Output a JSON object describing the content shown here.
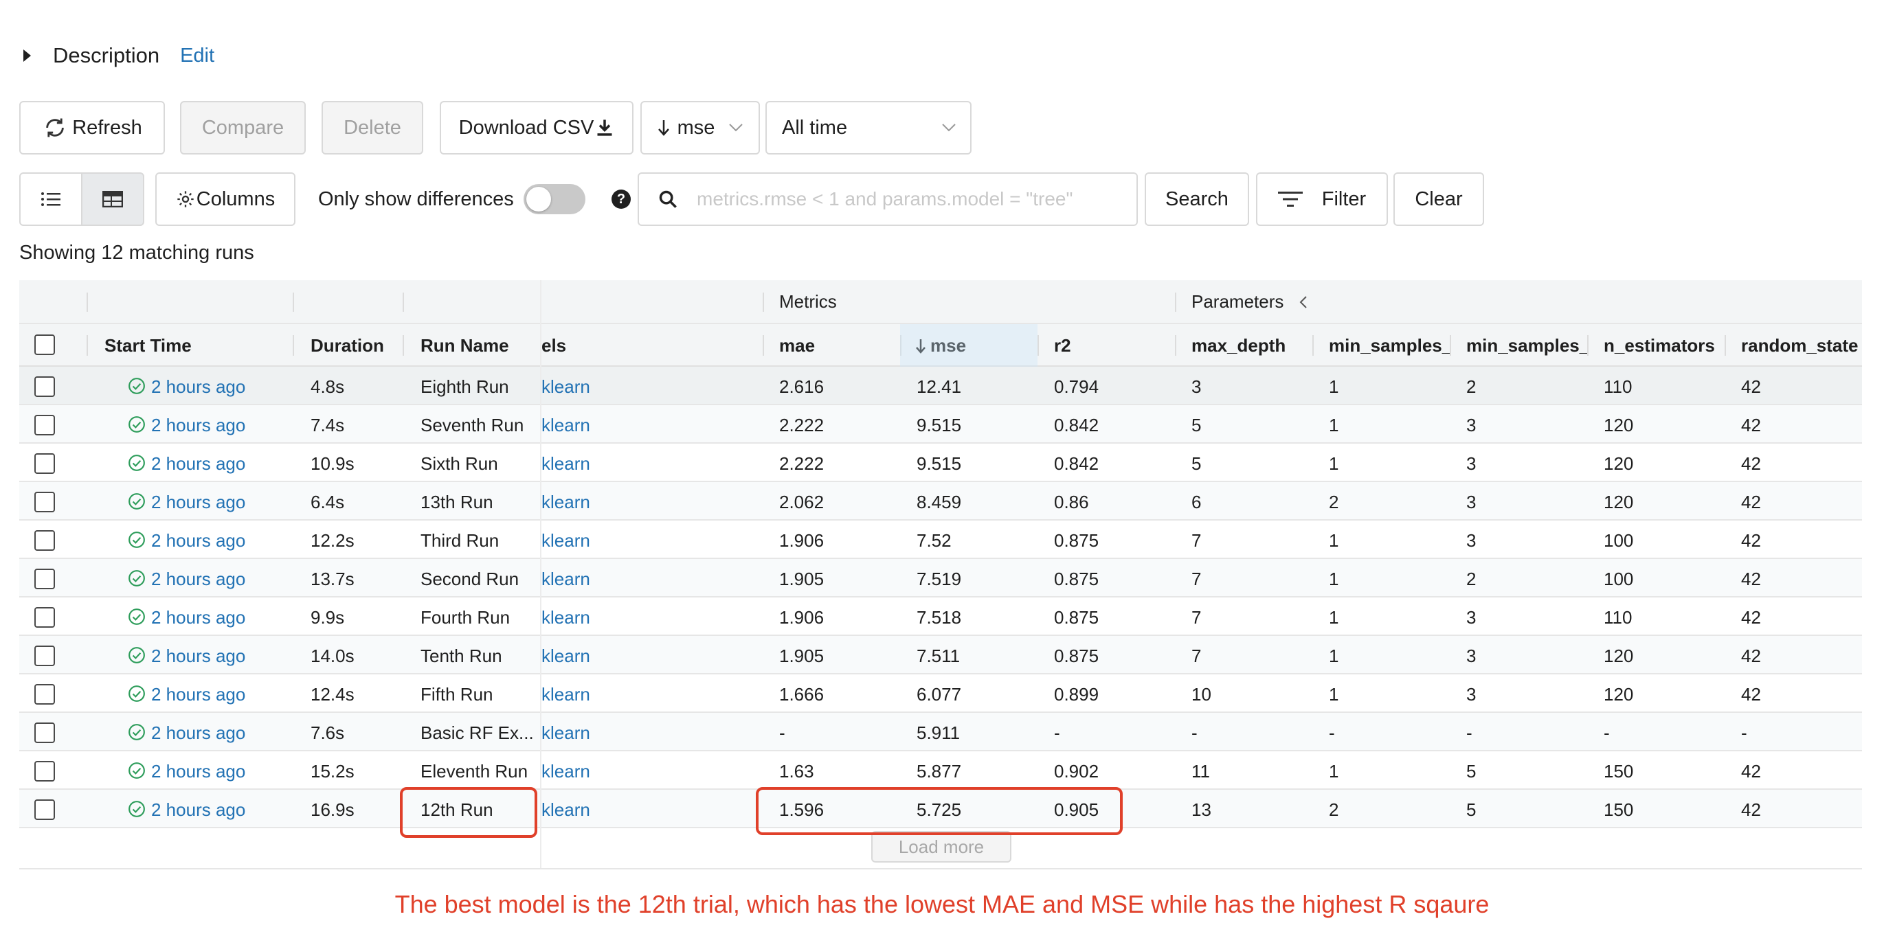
{
  "description": {
    "title": "Description",
    "edit_label": "Edit"
  },
  "toolbar": {
    "refresh_label": "Refresh",
    "compare_label": "Compare",
    "delete_label": "Delete",
    "download_label": "Download CSV",
    "sort_label": "mse",
    "time_label": "All time"
  },
  "filter_bar": {
    "columns_label": "Columns",
    "only_diff_label": "Only show differences",
    "search_placeholder": "metrics.rmse < 1 and params.model = \"tree\"",
    "search_label": "Search",
    "filter_label": "Filter",
    "clear_label": "Clear"
  },
  "count_text": "Showing 12 matching runs",
  "table": {
    "groups": {
      "metrics": "Metrics",
      "parameters": "Parameters"
    },
    "columns": {
      "start_time": "Start Time",
      "duration": "Duration",
      "run_name": "Run Name",
      "models": "els",
      "mae": "mae",
      "mse": "mse",
      "r2": "r2",
      "max_depth": "max_depth",
      "min_samples_leaf": "min_samples_le",
      "min_samples_split": "min_samples_s",
      "n_estimators": "n_estimators",
      "random_state": "random_state"
    },
    "rows": [
      {
        "time": "2 hours ago",
        "duration": "4.8s",
        "name": "Eighth Run",
        "model": "klearn",
        "mae": "2.616",
        "mse": "12.41",
        "r2": "0.794",
        "max_depth": "3",
        "msl": "1",
        "mss": "2",
        "n_est": "110",
        "rs": "42"
      },
      {
        "time": "2 hours ago",
        "duration": "7.4s",
        "name": "Seventh Run",
        "model": "klearn",
        "mae": "2.222",
        "mse": "9.515",
        "r2": "0.842",
        "max_depth": "5",
        "msl": "1",
        "mss": "3",
        "n_est": "120",
        "rs": "42"
      },
      {
        "time": "2 hours ago",
        "duration": "10.9s",
        "name": "Sixth Run",
        "model": "klearn",
        "mae": "2.222",
        "mse": "9.515",
        "r2": "0.842",
        "max_depth": "5",
        "msl": "1",
        "mss": "3",
        "n_est": "120",
        "rs": "42"
      },
      {
        "time": "2 hours ago",
        "duration": "6.4s",
        "name": "13th Run",
        "model": "klearn",
        "mae": "2.062",
        "mse": "8.459",
        "r2": "0.86",
        "max_depth": "6",
        "msl": "2",
        "mss": "3",
        "n_est": "120",
        "rs": "42"
      },
      {
        "time": "2 hours ago",
        "duration": "12.2s",
        "name": "Third Run",
        "model": "klearn",
        "mae": "1.906",
        "mse": "7.52",
        "r2": "0.875",
        "max_depth": "7",
        "msl": "1",
        "mss": "3",
        "n_est": "100",
        "rs": "42"
      },
      {
        "time": "2 hours ago",
        "duration": "13.7s",
        "name": "Second Run",
        "model": "klearn",
        "mae": "1.905",
        "mse": "7.519",
        "r2": "0.875",
        "max_depth": "7",
        "msl": "1",
        "mss": "2",
        "n_est": "100",
        "rs": "42"
      },
      {
        "time": "2 hours ago",
        "duration": "9.9s",
        "name": "Fourth Run",
        "model": "klearn",
        "mae": "1.906",
        "mse": "7.518",
        "r2": "0.875",
        "max_depth": "7",
        "msl": "1",
        "mss": "3",
        "n_est": "110",
        "rs": "42"
      },
      {
        "time": "2 hours ago",
        "duration": "14.0s",
        "name": "Tenth Run",
        "model": "klearn",
        "mae": "1.905",
        "mse": "7.511",
        "r2": "0.875",
        "max_depth": "7",
        "msl": "1",
        "mss": "3",
        "n_est": "120",
        "rs": "42"
      },
      {
        "time": "2 hours ago",
        "duration": "12.4s",
        "name": "Fifth Run",
        "model": "klearn",
        "mae": "1.666",
        "mse": "6.077",
        "r2": "0.899",
        "max_depth": "10",
        "msl": "1",
        "mss": "3",
        "n_est": "120",
        "rs": "42"
      },
      {
        "time": "2 hours ago",
        "duration": "7.6s",
        "name": "Basic RF Ex...",
        "model": "klearn",
        "mae": "-",
        "mse": "5.911",
        "r2": "-",
        "max_depth": "-",
        "msl": "-",
        "mss": "-",
        "n_est": "-",
        "rs": "-"
      },
      {
        "time": "2 hours ago",
        "duration": "15.2s",
        "name": "Eleventh Run",
        "model": "klearn",
        "mae": "1.63",
        "mse": "5.877",
        "r2": "0.902",
        "max_depth": "11",
        "msl": "1",
        "mss": "5",
        "n_est": "150",
        "rs": "42"
      },
      {
        "time": "2 hours ago",
        "duration": "16.9s",
        "name": "12th Run",
        "model": "klearn",
        "mae": "1.596",
        "mse": "5.725",
        "r2": "0.905",
        "max_depth": "13",
        "msl": "2",
        "mss": "5",
        "n_est": "150",
        "rs": "42"
      }
    ],
    "load_more_label": "Load more"
  },
  "annotation": "The best model is the 12th trial, which has the lowest MAE and MSE while has the highest R sqaure",
  "colors": {
    "link": "#2272b4",
    "success": "#2e9d5b",
    "highlight": "#e0402a"
  }
}
